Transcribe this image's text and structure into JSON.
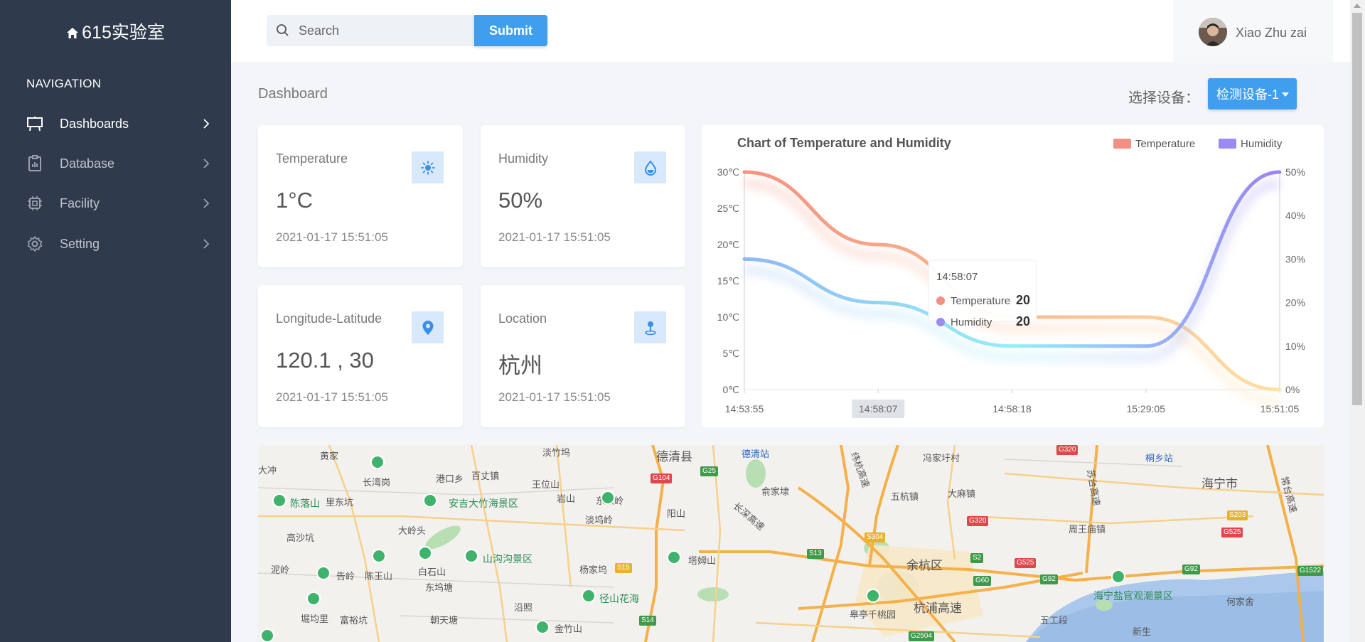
{
  "sidebar": {
    "brand": "615实验室",
    "nav_title": "NAVIGATION",
    "items": [
      {
        "label": "Dashboards",
        "icon": "dashboard-icon"
      },
      {
        "label": "Database",
        "icon": "clipboard-icon"
      },
      {
        "label": "Facility",
        "icon": "chip-icon"
      },
      {
        "label": "Setting",
        "icon": "gear-icon"
      }
    ]
  },
  "header": {
    "search_placeholder": "Search",
    "submit_label": "Submit",
    "user_name": "Xiao Zhu zai"
  },
  "page": {
    "title": "Dashboard",
    "device_label": "选择设备：",
    "device_selected": "检测设备-1"
  },
  "cards": [
    {
      "label": "Temperature",
      "value": "1°C",
      "time": "2021-01-17 15:51:05",
      "icon": "sun-icon"
    },
    {
      "label": "Humidity",
      "value": "50%",
      "time": "2021-01-17 15:51:05",
      "icon": "water-drop-icon"
    },
    {
      "label": "Longitude-Latitude",
      "value": "120.1 , 30",
      "time": "2021-01-17 15:51:05",
      "icon": "map-pin-icon"
    },
    {
      "label": "Location",
      "value": "杭州",
      "time": "2021-01-17 15:51:05",
      "icon": "location-marker-icon"
    }
  ],
  "chart_data": {
    "type": "line",
    "title": "Chart of Temperature and Humidity",
    "categories": [
      "14:53:55",
      "14:58:07",
      "14:58:18",
      "15:29:05",
      "15:51:05"
    ],
    "series": [
      {
        "name": "Temperature",
        "axis": "left",
        "values": [
          30,
          20,
          10,
          10,
          0
        ],
        "color": "#f58f83"
      },
      {
        "name": "Humidity",
        "axis": "right",
        "values": [
          30,
          20,
          10,
          10,
          50
        ],
        "color": "#9b8af2"
      }
    ],
    "y_left_ticks": [
      "0℃",
      "5℃",
      "10℃",
      "15℃",
      "20℃",
      "25℃",
      "30℃"
    ],
    "y_right_ticks": [
      "0%",
      "10%",
      "20%",
      "30%",
      "40%",
      "50%"
    ],
    "ylim_left": [
      0,
      30
    ],
    "ylim_right": [
      0,
      50
    ],
    "legend_position": "top-right",
    "tooltip": {
      "time": "14:58:07",
      "rows": [
        {
          "name": "Temperature",
          "value": "20",
          "color": "#f58f83"
        },
        {
          "name": "Humidity",
          "value": "20",
          "color": "#9b8af2"
        }
      ]
    },
    "highlight_category": "14:58:07"
  },
  "map": {
    "labels": [
      "黄家",
      "长湾岗",
      "港口乡",
      "百丈镇",
      "淡竹坞",
      "德清县",
      "德清站",
      "纬杭高速",
      "冯家圩村",
      "苏台高速",
      "桐乡站",
      "海宁市",
      "常台高速",
      "陈落山",
      "里东坑",
      "安吉大竹海景区",
      "王位山",
      "岩山",
      "东顺岭",
      "俞家埭",
      "五杭镇",
      "大麻镇",
      "周王庙镇",
      "高沙坑",
      "大岭头",
      "淡坞岭",
      "阳山",
      "长深高速",
      "告岭",
      "陈王山",
      "白石山",
      "山沟沟景区",
      "塔姆山",
      "余杭区",
      "海宁盐官观潮景区",
      "泥岭",
      "东坞塘",
      "杨家坞",
      "堀均里",
      "富裕坑",
      "朝天塘",
      "沿照",
      "径山花海",
      "金竹山",
      "皋亭千桃园",
      "杭浦高速",
      "五工段",
      "新生",
      "何家舍",
      "大冲"
    ],
    "highways": [
      "G104",
      "G25",
      "G320",
      "S304",
      "S13",
      "G320",
      "S2",
      "G525",
      "G60",
      "G92",
      "S203",
      "G525",
      "G92",
      "G1522",
      "S15",
      "S14",
      "G2504"
    ]
  },
  "colors": {
    "sidebar_bg": "#2f3a4c",
    "accent": "#409eef",
    "card_icon_bg": "#d7e9fb"
  }
}
